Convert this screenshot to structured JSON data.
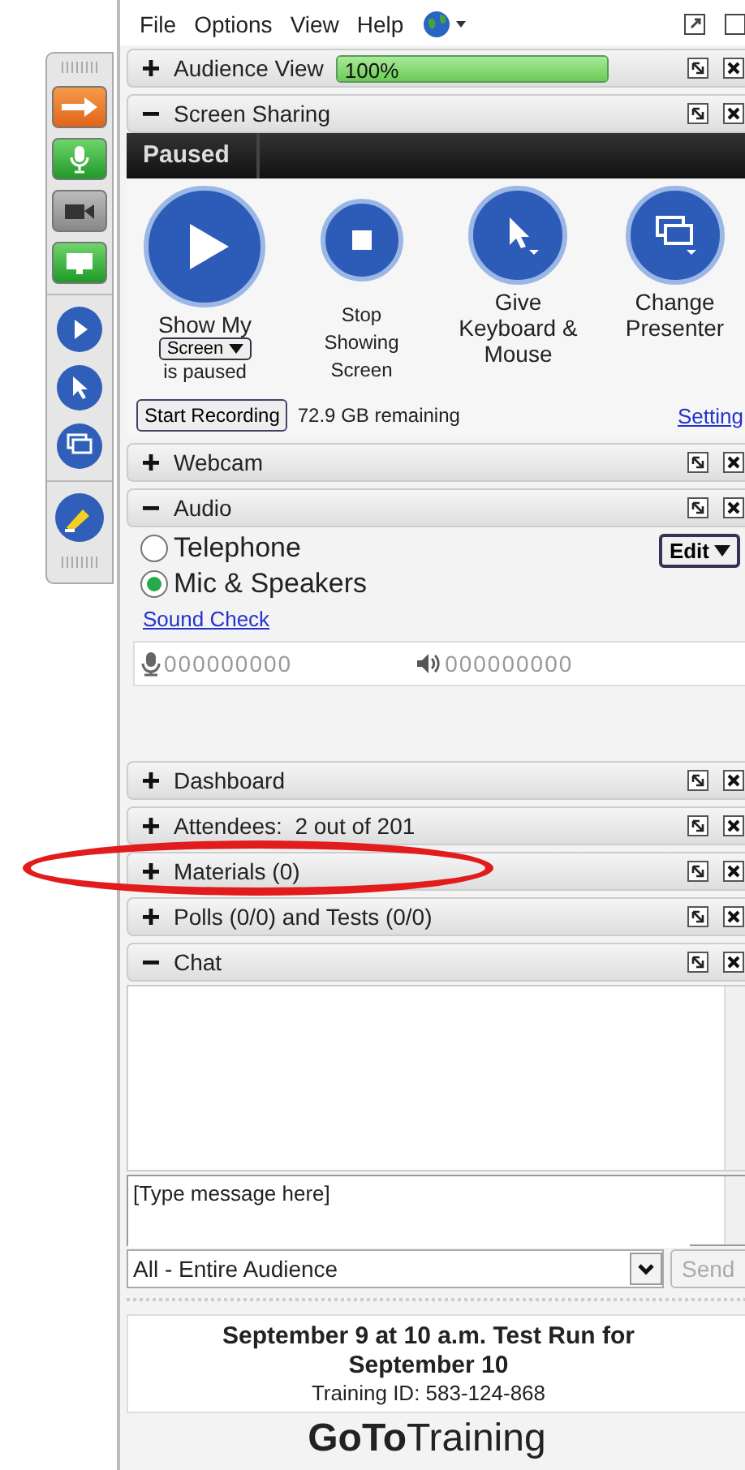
{
  "menu_bar": {
    "items": [
      "File",
      "Options",
      "View",
      "Help"
    ]
  },
  "panels": [
    {
      "kind": "audience",
      "title": "Audience View",
      "expanded": false,
      "meter": {
        "level": 1,
        "reading": "100%"
      }
    },
    {
      "kind": "screen_sharing",
      "title": "Screen Sharing",
      "expanded": true,
      "status": "Paused",
      "actions": [
        {
          "kind": "show",
          "label": "Show My",
          "dropdown": "Screen",
          "note": "is paused"
        },
        {
          "kind": "stop",
          "label": "Stop Showing Screen"
        },
        {
          "kind": "keyboard",
          "label": "Give Keyboard & Mouse"
        },
        {
          "kind": "presenter",
          "label": "Change Presenter"
        }
      ],
      "record_button": "Start Recording",
      "remaining": "72.9 GB remaining",
      "settings_link": "Setting"
    },
    {
      "kind": "plain",
      "title": "Webcam",
      "expanded": false
    },
    {
      "kind": "audio",
      "title": "Audio",
      "expanded": true,
      "edit_button": "Edit",
      "options": [
        {
          "label": "Telephone",
          "selected": false
        },
        {
          "label": "Mic & Speakers",
          "selected": true
        }
      ],
      "sound_check": "Sound Check",
      "mic_reading": "000000000",
      "speaker_reading": "000000000"
    },
    {
      "kind": "plain",
      "title": "Dashboard",
      "expanded": false
    },
    {
      "kind": "plain",
      "title": "Attendees:  2 out of 201",
      "expanded": false
    },
    {
      "kind": "plain",
      "title": "Materials (0)",
      "expanded": false
    },
    {
      "kind": "plain",
      "title": "Polls (0/0) and Tests (0/0)",
      "expanded": false
    },
    {
      "kind": "chat",
      "title": "Chat",
      "expanded": true,
      "message_placeholder": "[Type message here]",
      "recipient": "All - Entire Audience",
      "send_button": "Send"
    }
  ],
  "session": {
    "title": "September 9 at 10 a.m. Test Run for September 10",
    "training_id": "Training ID: 583-124-868"
  },
  "logo": "**GoTo**Training"
}
